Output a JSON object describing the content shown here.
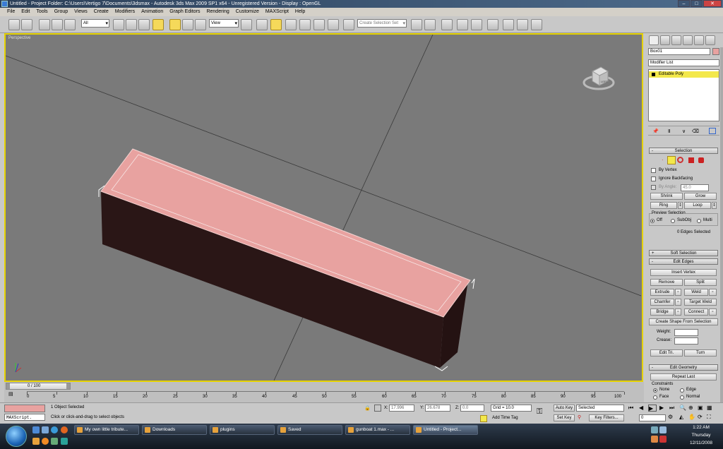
{
  "titlebar": {
    "text": "Untitled   - Project Folder: C:\\Users\\Vertigo 7\\Documents\\3dsmax    - Autodesk 3ds Max  2009 SP1  x64  - Unregistered Version    - Display : OpenGL"
  },
  "menu": [
    "File",
    "Edit",
    "Tools",
    "Group",
    "Views",
    "Create",
    "Modifiers",
    "Animation",
    "Graph Editors",
    "Rendering",
    "Customize",
    "MAXScript",
    "Help"
  ],
  "toolbar": {
    "filter_value": "All",
    "refcoord_value": "View",
    "named_sel_placeholder": "Create Selection Set"
  },
  "viewport": {
    "label": "Perspective",
    "viewcube_face": "LEFT"
  },
  "command_panel": {
    "object_name": "Box01",
    "modifier_list_label": "Modifier List",
    "stack_item": "Editable Poly",
    "rollouts": {
      "selection": {
        "title": "Selection",
        "by_vertex": "By Vertex",
        "ignore_backfacing": "Ignore Backfacing",
        "by_angle": "By Angle:",
        "angle_value": "45.0",
        "shrink": "Shrink",
        "grow": "Grow",
        "ring": "Ring",
        "loop": "Loop",
        "preview_label": "Preview Selection",
        "preview_off": "Off",
        "preview_subobj": "SubObj",
        "preview_multi": "Multi",
        "status": "0 Edges Selected"
      },
      "soft_selection": {
        "title": "Soft Selection",
        "toggle": "+"
      },
      "edit_edges": {
        "title": "Edit Edges",
        "insert_vertex": "Insert Vertex",
        "remove": "Remove",
        "split": "Split",
        "extrude": "Extrude",
        "weld": "Weld",
        "chamfer": "Chamfer",
        "target_weld": "Target Weld",
        "bridge": "Bridge",
        "connect": "Connect",
        "create_shape": "Create Shape From Selection",
        "weight": "Weight:",
        "crease": "Crease:",
        "edit_tri": "Edit Tri.",
        "turn": "Turn"
      },
      "edit_geometry": {
        "title": "Edit Geometry",
        "repeat_last": "Repeat Last",
        "constraints": "Constraints",
        "none": "None",
        "edge": "Edge",
        "face": "Face",
        "normal": "Normal"
      }
    }
  },
  "timeline": {
    "slider": "0 / 100",
    "ticks": [
      "0",
      "5",
      "10",
      "15",
      "20",
      "25",
      "30",
      "35",
      "40",
      "45",
      "50",
      "55",
      "60",
      "65",
      "70",
      "75",
      "80",
      "85",
      "90",
      "95",
      "100"
    ]
  },
  "status": {
    "maxscript": "MAXScript.",
    "objects": "1 Object Selected",
    "prompt": "Click or click-and-drag to select objects",
    "x_label": "X:",
    "x_value": "17.996",
    "y_label": "Y:",
    "y_value": "26.678",
    "z_label": "Z:",
    "z_value": "0.0",
    "grid": "Grid = 10.0",
    "add_time_tag": "Add Time Tag",
    "auto_key": "Auto Key",
    "set_key": "Set Key",
    "key_mode_value": "Selected",
    "key_filters": "Key Filters...",
    "frame_value": "0"
  },
  "taskbar": {
    "tasks": [
      "My own little tribute...",
      "Downloads",
      "plugins",
      "Saved",
      "gunboat 1.max - ...",
      "Untitled   - Project..."
    ],
    "time": "1:22 AM",
    "day": "Thursday",
    "date": "12/11/2008"
  },
  "colors": {
    "selection_highlight": "#e6d200",
    "box_top": "#e8a2a0",
    "box_side": "#2a1616",
    "viewport_bg": "#7a7a7a"
  }
}
